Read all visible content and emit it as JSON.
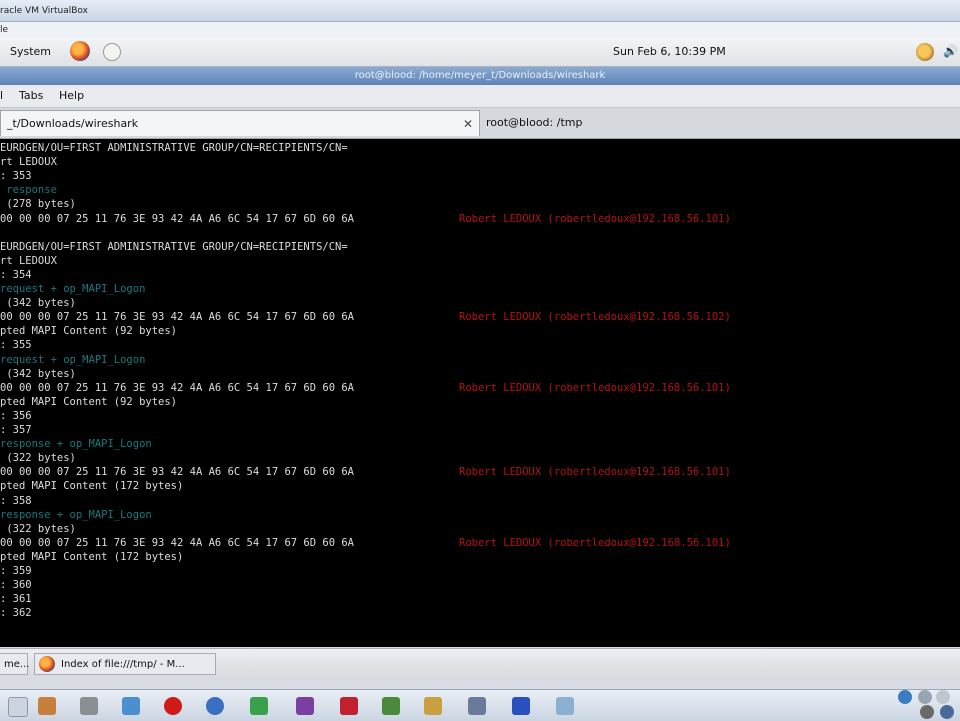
{
  "vbox": {
    "title": "racle VM VirtualBox",
    "menu_item": "le"
  },
  "top_panel": {
    "system_label": "System",
    "clock": "Sun Feb  6, 10:39 PM"
  },
  "terminal_window": {
    "title": "root@blood: /home/meyer_t/Downloads/wireshark",
    "menu": [
      "l",
      "Tabs",
      "Help"
    ],
    "tabs": [
      {
        "label": "_t/Downloads/wireshark",
        "active": true
      },
      {
        "label": "root@blood: /tmp",
        "active": false
      }
    ]
  },
  "terminal": {
    "lines": [
      "EURDGEN/OU=FIRST ADMINISTRATIVE GROUP/CN=RECIPIENTS/CN=",
      "rt LEDOUX",
      ": 353",
      " response",
      " (278 bytes)",
      "00 00 00 07 25 11 76 3E 93 42 4A A6 6C 54 17 67 6D 60 6A",
      "",
      "EURDGEN/OU=FIRST ADMINISTRATIVE GROUP/CN=RECIPIENTS/CN=",
      "rt LEDOUX",
      ": 354",
      "request + op_MAPI_Logon",
      " (342 bytes)",
      "00 00 00 07 25 11 76 3E 93 42 4A A6 6C 54 17 67 6D 60 6A",
      "pted MAPI Content (92 bytes)",
      ": 355",
      "request + op_MAPI_Logon",
      " (342 bytes)",
      "00 00 00 07 25 11 76 3E 93 42 4A A6 6C 54 17 67 6D 60 6A",
      "pted MAPI Content (92 bytes)",
      ": 356",
      ": 357",
      "response + op_MAPI_Logon",
      " (322 bytes)",
      "00 00 00 07 25 11 76 3E 93 42 4A A6 6C 54 17 67 6D 60 6A",
      "pted MAPI Content (172 bytes)",
      ": 358",
      "response + op_MAPI_Logon",
      " (322 bytes)",
      "00 00 00 07 25 11 76 3E 93 42 4A A6 6C 54 17 67 6D 60 6A",
      "pted MAPI Content (172 bytes)",
      ": 359",
      ": 360",
      ": 361",
      ": 362"
    ],
    "cyan_lines": [
      3,
      10,
      15,
      21,
      26
    ],
    "red_labels": [
      "Robert LEDOUX (robertledoux@192.168.56.101)",
      "Robert LEDOUX (robertledoux@192.168.56.102)",
      "Robert LEDOUX (robertledoux@192.168.56.101)",
      "Robert LEDOUX (robertledoux@192.168.56.101)",
      "Robert LEDOUX (robertledoux@192.168.56.101)"
    ],
    "red_line_index": [
      5,
      12,
      17,
      23,
      28
    ]
  },
  "bottom_panel": {
    "tasks": [
      "me...",
      "Index of file:///tmp/ - M..."
    ]
  },
  "colors": {
    "terminal_bg": "#000000",
    "terminal_fg": "#dcdcdc",
    "cyan": "#167a7e",
    "red": "#b41212",
    "title_blue": "#6f94c4"
  }
}
